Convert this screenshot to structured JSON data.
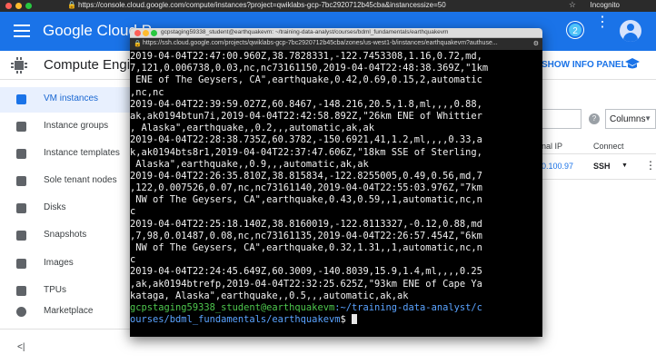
{
  "browser": {
    "url": "https://console.cloud.google.com/compute/instances?project=qwiklabs-gcp-7bc2920712b45cba&instancessize=50",
    "profile": "Incognito"
  },
  "header": {
    "brand": "Google Cloud P",
    "notification_count": "2"
  },
  "subheader": {
    "title": "Compute Engine",
    "show_info_panel": "SHOW INFO PANEL"
  },
  "sidebar": {
    "items": [
      {
        "label": "VM instances",
        "icon": "vm-icon",
        "active": true
      },
      {
        "label": "Instance groups",
        "icon": "instance-groups-icon",
        "active": false
      },
      {
        "label": "Instance templates",
        "icon": "instance-templates-icon",
        "active": false
      },
      {
        "label": "Sole tenant nodes",
        "icon": "sole-tenant-icon",
        "active": false
      },
      {
        "label": "Disks",
        "icon": "disk-icon",
        "active": false
      },
      {
        "label": "Snapshots",
        "icon": "snapshot-icon",
        "active": false
      },
      {
        "label": "Images",
        "icon": "image-icon",
        "active": false
      },
      {
        "label": "TPUs",
        "icon": "tpu-icon",
        "active": false
      },
      {
        "label": "Marketplace",
        "icon": "marketplace-icon",
        "active": false
      }
    ],
    "collapse": "<|"
  },
  "main": {
    "columns_label": "Columns",
    "help": "?",
    "col_external_ip": "nal IP",
    "col_connect": "Connect",
    "row": {
      "external_ip": "0.100.97",
      "connect": "SSH"
    }
  },
  "terminal": {
    "window_title": "gcpstaging59338_student@earthquakevm: ~/training-data-analyst/courses/bdml_fundamentals/earthquakevm",
    "url": "https://ssh.cloud.google.com/projects/qwiklabs-gcp-7bc2920712b45cba/zones/us-west1-b/instances/earthquakevm?authuse...",
    "lines": [
      "2019-04-04T22:47:00.960Z,38.7828331,-122.7453308,1.16,0.72,md,",
      "7,121,0.006738,0.03,nc,nc73161150,2019-04-04T22:48:38.369Z,\"1km",
      " ENE of The Geysers, CA\",earthquake,0.42,0.69,0.15,2,automatic",
      ",nc,nc",
      "2019-04-04T22:39:59.027Z,60.8467,-148.216,20.5,1.8,ml,,,,0.88,",
      "ak,ak0194btun7i,2019-04-04T22:42:58.892Z,\"26km ENE of Whittier",
      ", Alaska\",earthquake,,0.2,,,automatic,ak,ak",
      "2019-04-04T22:28:38.735Z,60.3782,-150.6921,41,1.2,ml,,,,0.33,a",
      "k,ak0194bts8r1,2019-04-04T22:37:47.606Z,\"18km SSE of Sterling,",
      " Alaska\",earthquake,,0.9,,,automatic,ak,ak",
      "2019-04-04T22:26:35.810Z,38.815834,-122.8255005,0.49,0.56,md,7",
      ",122,0.007526,0.07,nc,nc73161140,2019-04-04T22:55:03.976Z,\"7km",
      " NW of The Geysers, CA\",earthquake,0.43,0.59,,1,automatic,nc,n",
      "c",
      "2019-04-04T22:25:18.140Z,38.8160019,-122.8113327,-0.12,0.88,md",
      ",7,98,0.01487,0.08,nc,nc73161135,2019-04-04T22:26:57.454Z,\"6km",
      " NW of The Geysers, CA\",earthquake,0.32,1.31,,1,automatic,nc,n",
      "c",
      "2019-04-04T22:24:45.649Z,60.3009,-140.8039,15.9,1.4,ml,,,,0.25",
      ",ak,ak0194btrefp,2019-04-04T22:32:25.625Z,\"93km ENE of Cape Ya",
      "kataga, Alaska\",earthquake,,0.5,,,automatic,ak,ak"
    ],
    "prompt_user": "gcpstaging59338_student@earthquakevm",
    "prompt_path_1": ":~/training-data-analyst/c",
    "prompt_path_2": "ourses/bdml_fundamentals/earthquakevm",
    "prompt_symbol": "$ "
  }
}
